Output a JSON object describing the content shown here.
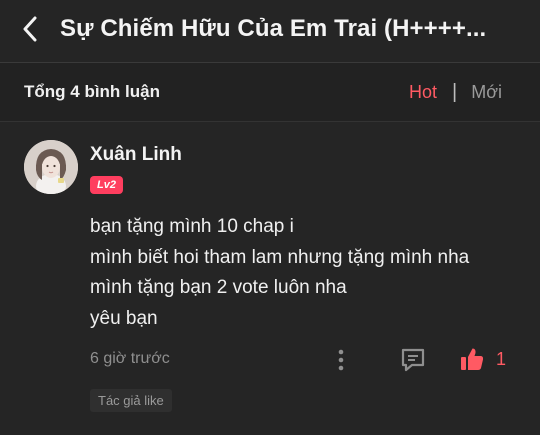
{
  "header": {
    "title": "Sự Chiếm Hữu Của Em Trai (H++++..."
  },
  "comments_section": {
    "count_label": "Tổng 4 bình luận",
    "sort_hot": "Hot",
    "sort_separator": "|",
    "sort_new": "Mới",
    "active_sort": "Hot"
  },
  "comment": {
    "author": "Xuân Linh",
    "level": "Lv2",
    "lines": [
      "bạn tặng mình 10 chap i",
      "mình biết hoi tham lam nhưng tặng mình nha",
      "mình tặng bạn 2 vote luôn nha",
      "yêu bạn"
    ],
    "time": "6 giờ trước",
    "likes": "1",
    "author_liked": "Tác giả like"
  },
  "colors": {
    "background": "#252525",
    "header_strip": "#222222",
    "accent": "#ff5a63",
    "badge": "#ff3e5f",
    "muted": "#8f8f8f"
  },
  "icons": {
    "back": "chevron-left-icon",
    "more": "more-vertical-icon",
    "reply": "comment-icon",
    "like": "thumbs-up-icon"
  }
}
